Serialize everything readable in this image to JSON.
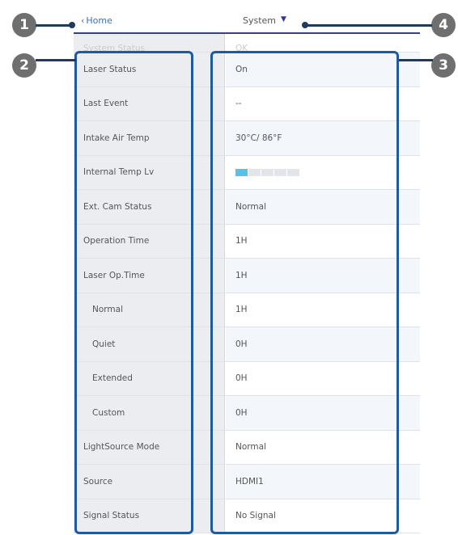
{
  "nav": {
    "home_label": "Home",
    "home_prefix": "‹",
    "system_label": "System",
    "system_caret": "▼"
  },
  "cut_row": {
    "label": "System Status",
    "value": "OK"
  },
  "rows": [
    {
      "label": "Laser Status",
      "value": "On"
    },
    {
      "label": "Last Event",
      "value": "--"
    },
    {
      "label": "Intake Air Temp",
      "value": "30°C/ 86°F"
    },
    {
      "label": "Internal Temp Lv",
      "value": ""
    },
    {
      "label": "Ext. Cam Status",
      "value": "Normal"
    },
    {
      "label": "Operation Time",
      "value": "1H"
    },
    {
      "label": "Laser Op.Time",
      "value": "1H"
    },
    {
      "label": "Normal",
      "value": "1H"
    },
    {
      "label": "Quiet",
      "value": "0H"
    },
    {
      "label": "Extended",
      "value": "0H"
    },
    {
      "label": "Custom",
      "value": "0H"
    },
    {
      "label": "LightSource Mode",
      "value": "Normal"
    },
    {
      "label": "Source",
      "value": "HDMI1"
    },
    {
      "label": "Signal Status",
      "value": "No Signal"
    }
  ],
  "internal_temp_level": {
    "filled_segments": 1,
    "total_segments": 5
  },
  "callouts": [
    "1",
    "2",
    "3",
    "4"
  ],
  "colors": {
    "accent_blue": "#1f5b9c",
    "nav_underline": "#3a3f8c",
    "temp_fill": "#55c2e8",
    "badge_gray": "#6f6f6f"
  }
}
